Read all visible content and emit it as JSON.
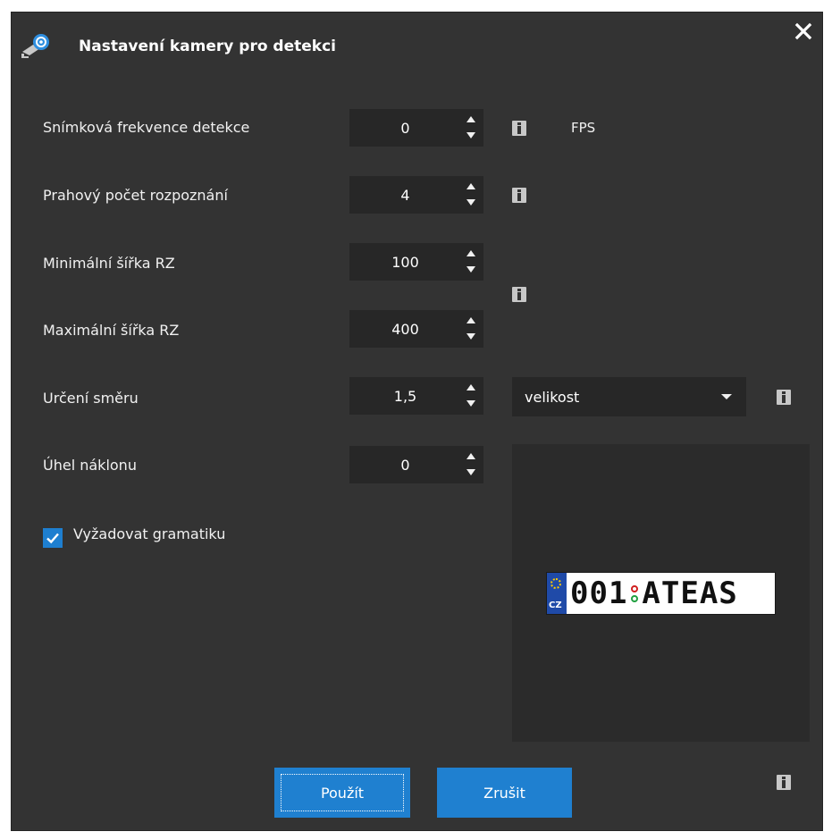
{
  "dialog": {
    "title": "Nastavení kamery pro detekci",
    "title_icon": "camera-settings-icon",
    "close_icon": "close-icon"
  },
  "fields": {
    "fps": {
      "label": "Snímková frekvence detekce",
      "value": "0",
      "unit": "FPS"
    },
    "threshold": {
      "label": "Prahový počet rozpoznání",
      "value": "4"
    },
    "min_width": {
      "label": "Minimální šířka RZ",
      "value": "100"
    },
    "max_width": {
      "label": "Maximální šířka RZ",
      "value": "400"
    },
    "direction": {
      "label": "Určení směru",
      "value": "1,5",
      "mode_selected": "velikost"
    },
    "tilt": {
      "label": "Úhel náklonu",
      "value": "0"
    }
  },
  "grammar": {
    "label": "Vyžadovat gramatiku",
    "checked": true
  },
  "preview": {
    "plate_country": "CZ",
    "plate_left": "001",
    "plate_right": "ATEAS"
  },
  "buttons": {
    "apply": "Použít",
    "cancel": "Zrušit"
  },
  "colors": {
    "background": "#333333",
    "input_background": "#272727",
    "accent": "#1f80d0"
  }
}
